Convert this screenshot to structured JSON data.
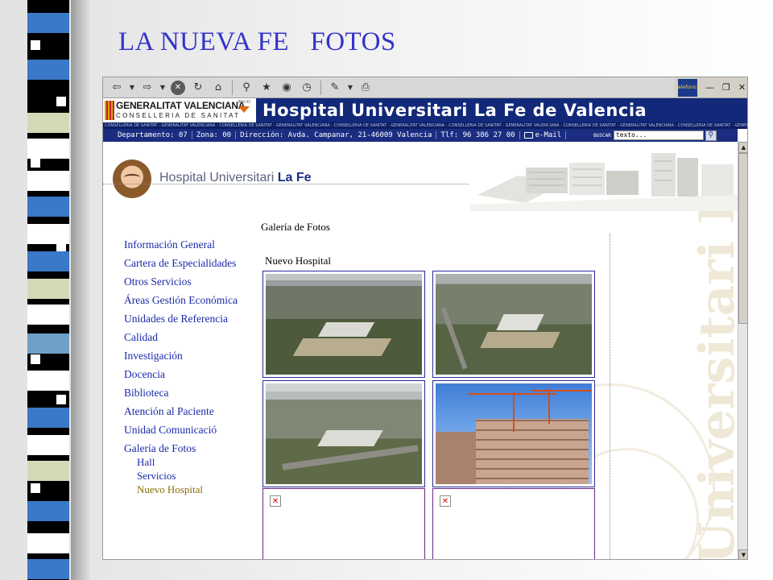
{
  "slide": {
    "title": "LA NUEVA FE   FOTOS"
  },
  "browser": {
    "toolbar_icons": [
      "back-arrow-icon",
      "dropdown-icon",
      "forward-arrow-icon",
      "dropdown-icon",
      "stop-icon",
      "refresh-icon",
      "home-icon",
      "search-icon",
      "favorites-icon",
      "history-icon",
      "media-icon",
      "edit-icon",
      "print-icon"
    ],
    "brand_text": "Telefonica"
  },
  "site": {
    "gva_name": "GENERALITAT VALENCIANA",
    "gva_sub": "CONSELLERIA DE SANITAT",
    "inicio_label": "INICIO",
    "banner_title": "Hospital Universitari La Fe de Valencia",
    "ticker": "CONSELLERIA DE SANITAT - GENERALITAT VALENCIANA - CONSELLERIA DE SANITAT - GENERALITAT VALENCIANA - CONSELLERIA DE SANITAT - GENERALITAT VALENCIANA - CONSELLERIA DE SANITAT - GENERALITAT VALENCIANA - CONSELLERIA DE SANITAT - GENERALITAT VALENCIANA - CONSELLERIA DE SANITAT - GENERALITAT VALENCIANA - CONSELLERIA DE SANITAT",
    "departamento": "Departamento: 07",
    "zona": "Zona: 00",
    "direccion": "Dirección: Avda. Campanar, 21-46009 Valencia",
    "telefono": "Tlf: 96 386 27 00",
    "email_label": "e-Mail",
    "buscar_label": "BUSCAR",
    "search_value": "texto...",
    "logo_text_plain": "Hospital Universitari ",
    "logo_text_bold": "La Fe",
    "watermark": "Universitari La Fe"
  },
  "page": {
    "gallery_heading": "Galería de Fotos",
    "section_title": "Nuevo Hospital",
    "nav": [
      "Información General",
      "Cartera de Especialidades",
      "Otros Servicios",
      "Áreas Gestión Económica",
      "Unidades de Referencia",
      "Calidad",
      "Investigación",
      "Docencia",
      "Biblioteca",
      "Atención al Paciente",
      "Unidad Comunicació",
      "Galería de Fotos"
    ],
    "sub_nav": [
      "Hall",
      "Servicios",
      "Nuevo Hospital"
    ],
    "active_sub": "Nuevo Hospital"
  },
  "colors": {
    "title": "#3333cc",
    "banner": "#12297a",
    "link": "#1a2aa8",
    "active_link": "#8a6d00"
  }
}
